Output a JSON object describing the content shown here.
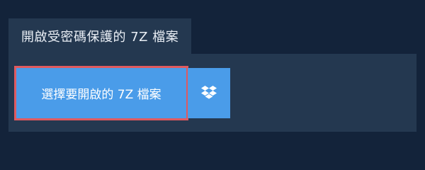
{
  "tab": {
    "label": "開啟受密碼保護的 7Z 檔案"
  },
  "panel": {
    "file_button_label": "選擇要開啟的 7Z 檔案",
    "dropbox_icon": "dropbox-icon"
  },
  "colors": {
    "background": "#13233a",
    "panel": "#243850",
    "button": "#4a9ce9",
    "focus_outline": "#e05a5f"
  }
}
